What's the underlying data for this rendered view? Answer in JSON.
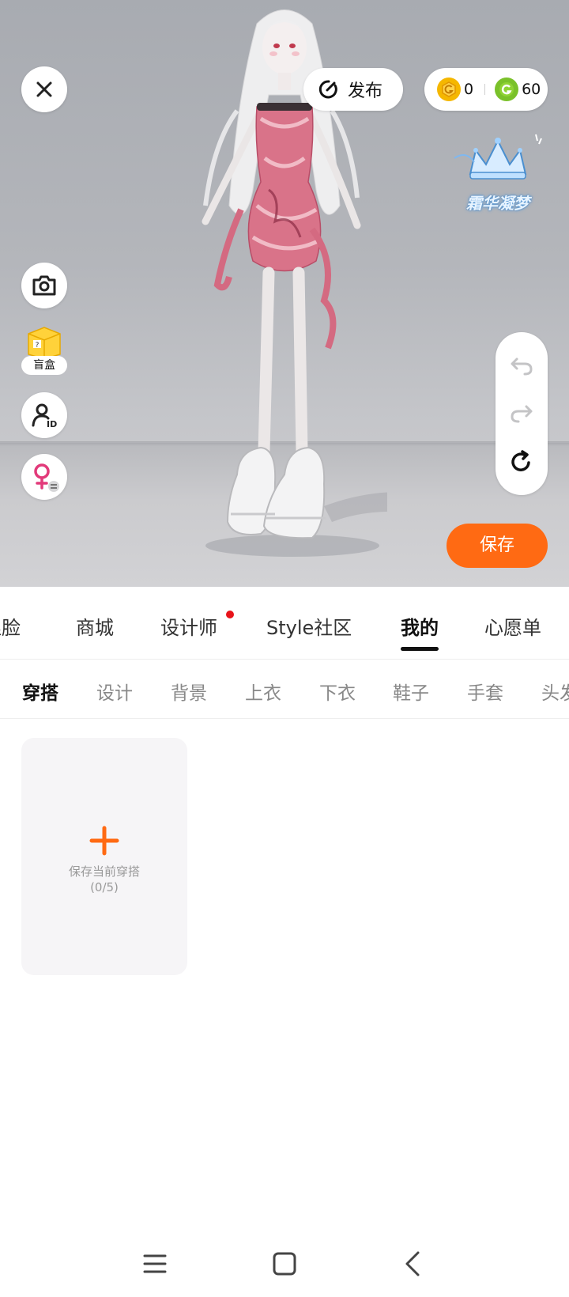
{
  "topbar": {
    "close_icon": "close-icon",
    "publish_label": "发布",
    "currency": [
      {
        "icon": "gold-g-coin-icon",
        "value": "0",
        "color": "#f5b700"
      },
      {
        "icon": "green-g-coin-icon",
        "value": "60",
        "color": "#7ac12a"
      }
    ]
  },
  "logo_text": "霜华凝梦",
  "left_tools": {
    "camera_icon": "camera-icon",
    "blindbox_label": "盲盒",
    "id_icon": "user-id-icon",
    "gender_icon": "female-swap-icon"
  },
  "right_tools": {
    "undo_icon": "undo-icon",
    "redo_icon": "redo-icon",
    "reset_icon": "reset-icon"
  },
  "save_label": "保存",
  "main_tabs": [
    {
      "label": "捏脸",
      "active": false
    },
    {
      "label": "商城",
      "active": false
    },
    {
      "label": "设计师",
      "active": false,
      "dot": true
    },
    {
      "label": "Style社区",
      "active": false
    },
    {
      "label": "我的",
      "active": true
    },
    {
      "label": "心愿单",
      "active": false
    }
  ],
  "sub_tabs": [
    {
      "label": "穿搭",
      "active": true
    },
    {
      "label": "设计",
      "active": false
    },
    {
      "label": "背景",
      "active": false
    },
    {
      "label": "上衣",
      "active": false
    },
    {
      "label": "下衣",
      "active": false
    },
    {
      "label": "鞋子",
      "active": false
    },
    {
      "label": "手套",
      "active": false
    },
    {
      "label": "头发",
      "active": false
    }
  ],
  "outfit": {
    "add_label": "保存当前穿搭",
    "count": "(0/5)"
  },
  "colors": {
    "accent": "#ff6a13",
    "badge": "#e8131a"
  }
}
